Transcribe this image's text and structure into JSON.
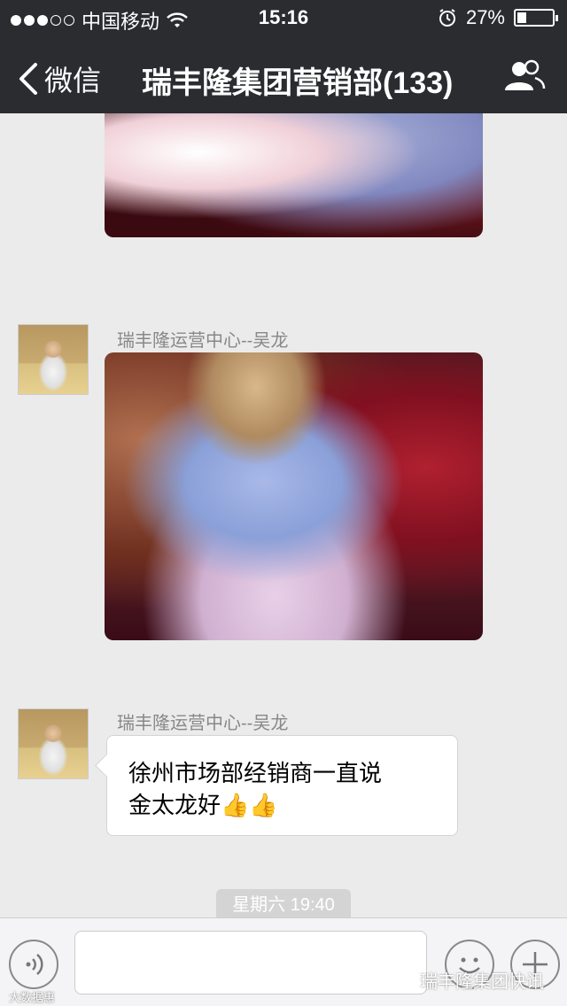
{
  "status_bar": {
    "carrier": "中国移动",
    "time": "15:16",
    "battery_percent": "27%",
    "battery_level": 0.27,
    "signal_icon": "signal-dots-icon",
    "wifi_icon": "wifi-icon",
    "alarm_icon": "alarm-clock-icon"
  },
  "nav": {
    "back_label": "微信",
    "title": "瑞丰隆集团营销部(133)",
    "back_icon": "chevron-left-icon",
    "group_icon": "group-members-icon"
  },
  "messages": [
    {
      "type": "image",
      "alt_description": "photo-fertilizer-bag"
    },
    {
      "type": "image",
      "sender": "瑞丰隆运营中心--吴龙",
      "avatar_icon": "user-avatar"
    },
    {
      "type": "text",
      "sender": "瑞丰隆运营中心--吴龙",
      "avatar_icon": "user-avatar",
      "line1": "徐州市场部经销商一直说",
      "line2": "金太龙好",
      "emoji": "👍👍"
    }
  ],
  "timestamp": "星期六 19:40",
  "input_bar": {
    "voice_icon": "voice-icon",
    "emoji_icon": "smiley-icon",
    "plus_icon": "plus-icon",
    "text_value": ""
  },
  "watermarks": {
    "left": "大数据惠",
    "right": "瑞丰隆集团快讯"
  },
  "colors": {
    "bar_bg": "#2a2c30",
    "chat_bg": "#ebebeb",
    "bubble_bg": "#ffffff",
    "time_pill": "#d4d4d4"
  }
}
